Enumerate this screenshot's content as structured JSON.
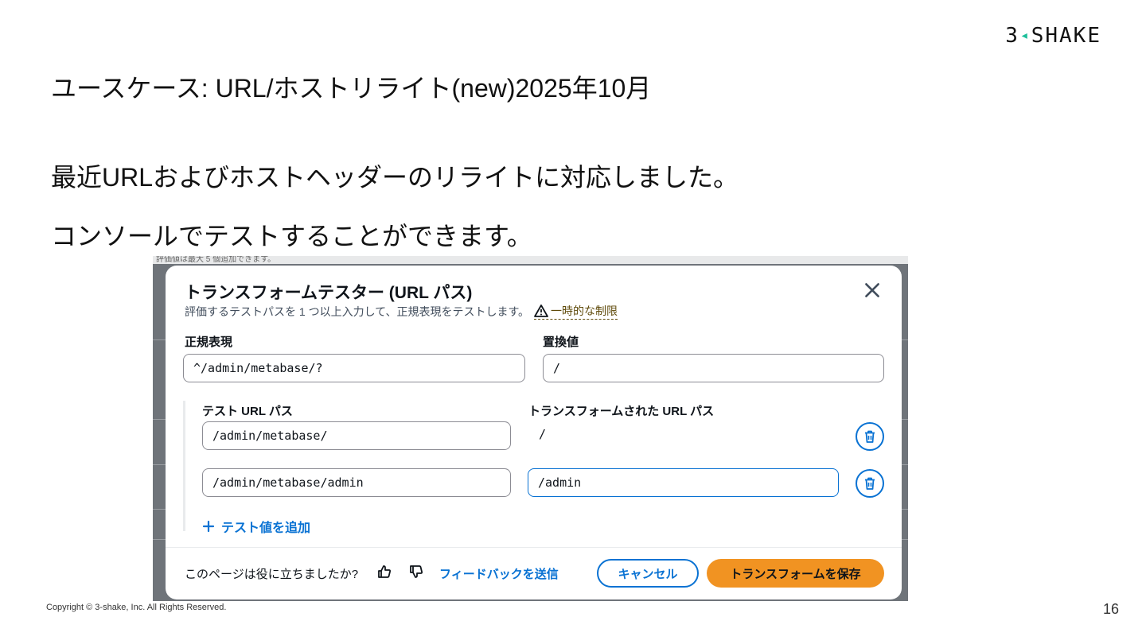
{
  "brand": {
    "logo_left": "3",
    "logo_right": "SHAKE"
  },
  "slide": {
    "title": "ユースケース: URL/ホストリライト(new)2025年10月",
    "line1": "最近URLおよびホストヘッダーのリライトに対応しました。",
    "line2": "コンソールでテストすることができます。"
  },
  "screenshot": {
    "background_top_text": "評価値は最大 5 個追加できます。",
    "modal": {
      "title": "トランスフォームテスター (URL パス)",
      "description": "評価するテストパスを 1 つ以上入力して、正規表現をテストします。",
      "warning_link": "一時的な制限",
      "regex_label": "正規表現",
      "regex_value": "^/admin/metabase/?",
      "replacement_label": "置換値",
      "replacement_value": "/",
      "test_path_label": "テスト URL パス",
      "transformed_label": "トランスフォームされた URL パス",
      "rows": [
        {
          "input": "/admin/metabase/",
          "output": "/"
        },
        {
          "input": "/admin/metabase/admin",
          "output": "/admin"
        }
      ],
      "add_test_label": "テスト値を追加",
      "footer": {
        "question": "このページは役に立ちましたか?",
        "feedback_link": "フィードバックを送信",
        "cancel_label": "キャンセル",
        "save_label": "トランスフォームを保存"
      }
    }
  },
  "copyright": "Copyright © 3-shake, Inc. All Rights Reserved.",
  "page_number": "16",
  "colors": {
    "accent": "#0972d3",
    "primary_button": "#f19322",
    "logo_accent": "#1bbf9a"
  }
}
